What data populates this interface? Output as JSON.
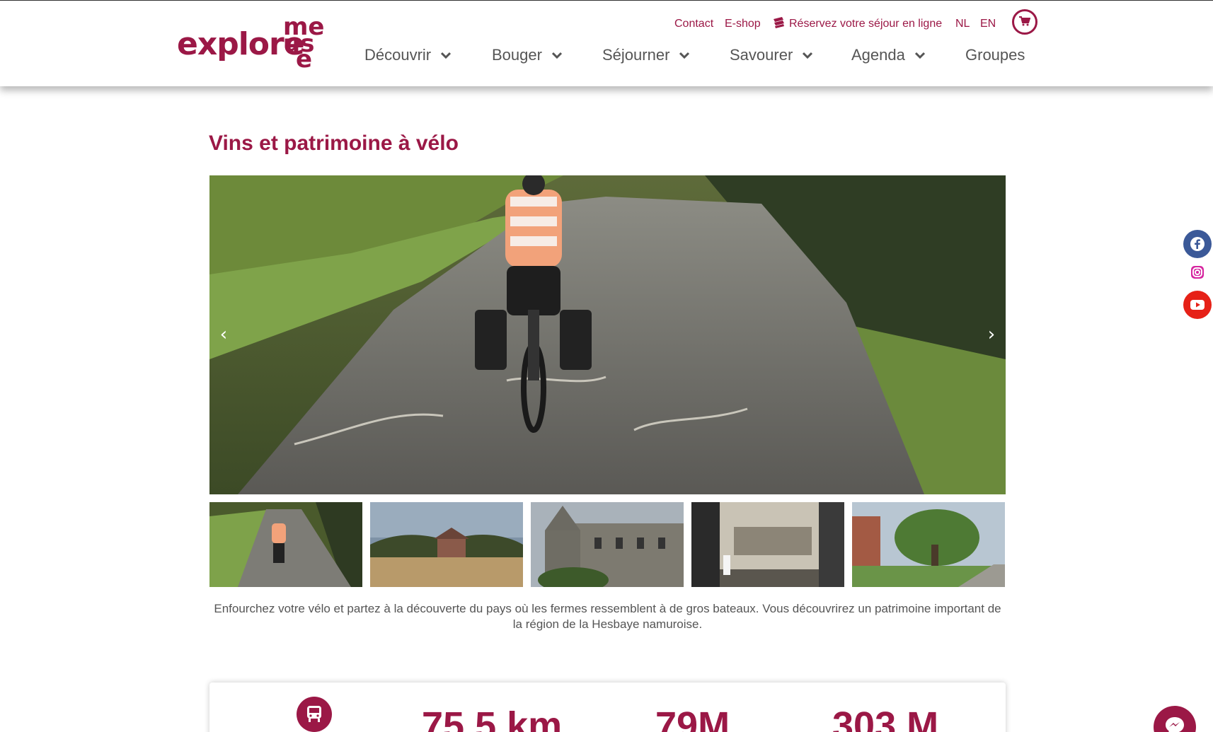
{
  "brand": {
    "logo_word": "explore",
    "logo_m1": "me",
    "logo_m2": "us",
    "logo_m3": "e",
    "accent": "#9b1846"
  },
  "utility_links": [
    {
      "label": "Contact"
    },
    {
      "label": "E-shop"
    },
    {
      "label": "Réservez votre séjour en ligne",
      "icon": "booking-icon"
    },
    {
      "label": "NL"
    },
    {
      "label": "EN"
    }
  ],
  "cart": {
    "icon": "cart-icon"
  },
  "nav": [
    {
      "label": "Découvrir",
      "has_dropdown": true
    },
    {
      "label": "Bouger",
      "has_dropdown": true
    },
    {
      "label": "Séjourner",
      "has_dropdown": true
    },
    {
      "label": "Savourer",
      "has_dropdown": true
    },
    {
      "label": "Agenda",
      "has_dropdown": true
    },
    {
      "label": "Groupes",
      "has_dropdown": false
    }
  ],
  "page": {
    "title": "Vins et patrimoine à vélo",
    "description": "Enfourchez votre vélo et partez à la découverte du pays où les fermes ressemblent à de gros bateaux. Vous découvrirez un patrimoine important de la région de la Hesbaye namuroise."
  },
  "slider": {
    "prev_icon": "chevron-left-icon",
    "next_icon": "chevron-right-icon",
    "prev_glyph": "‹",
    "next_glyph": "›",
    "thumbnail_count": 5
  },
  "stats": {
    "transport_icon": "bus-icon",
    "distance": "75,5 km",
    "elevation_gain": "79M",
    "elevation_max": "303 M"
  },
  "social": [
    {
      "icon": "facebook-icon",
      "color": "#3b5998"
    },
    {
      "icon": "instagram-icon",
      "color": "#c13584"
    },
    {
      "icon": "youtube-icon",
      "color": "#e62117"
    }
  ],
  "chat": {
    "icon": "messenger-icon"
  }
}
